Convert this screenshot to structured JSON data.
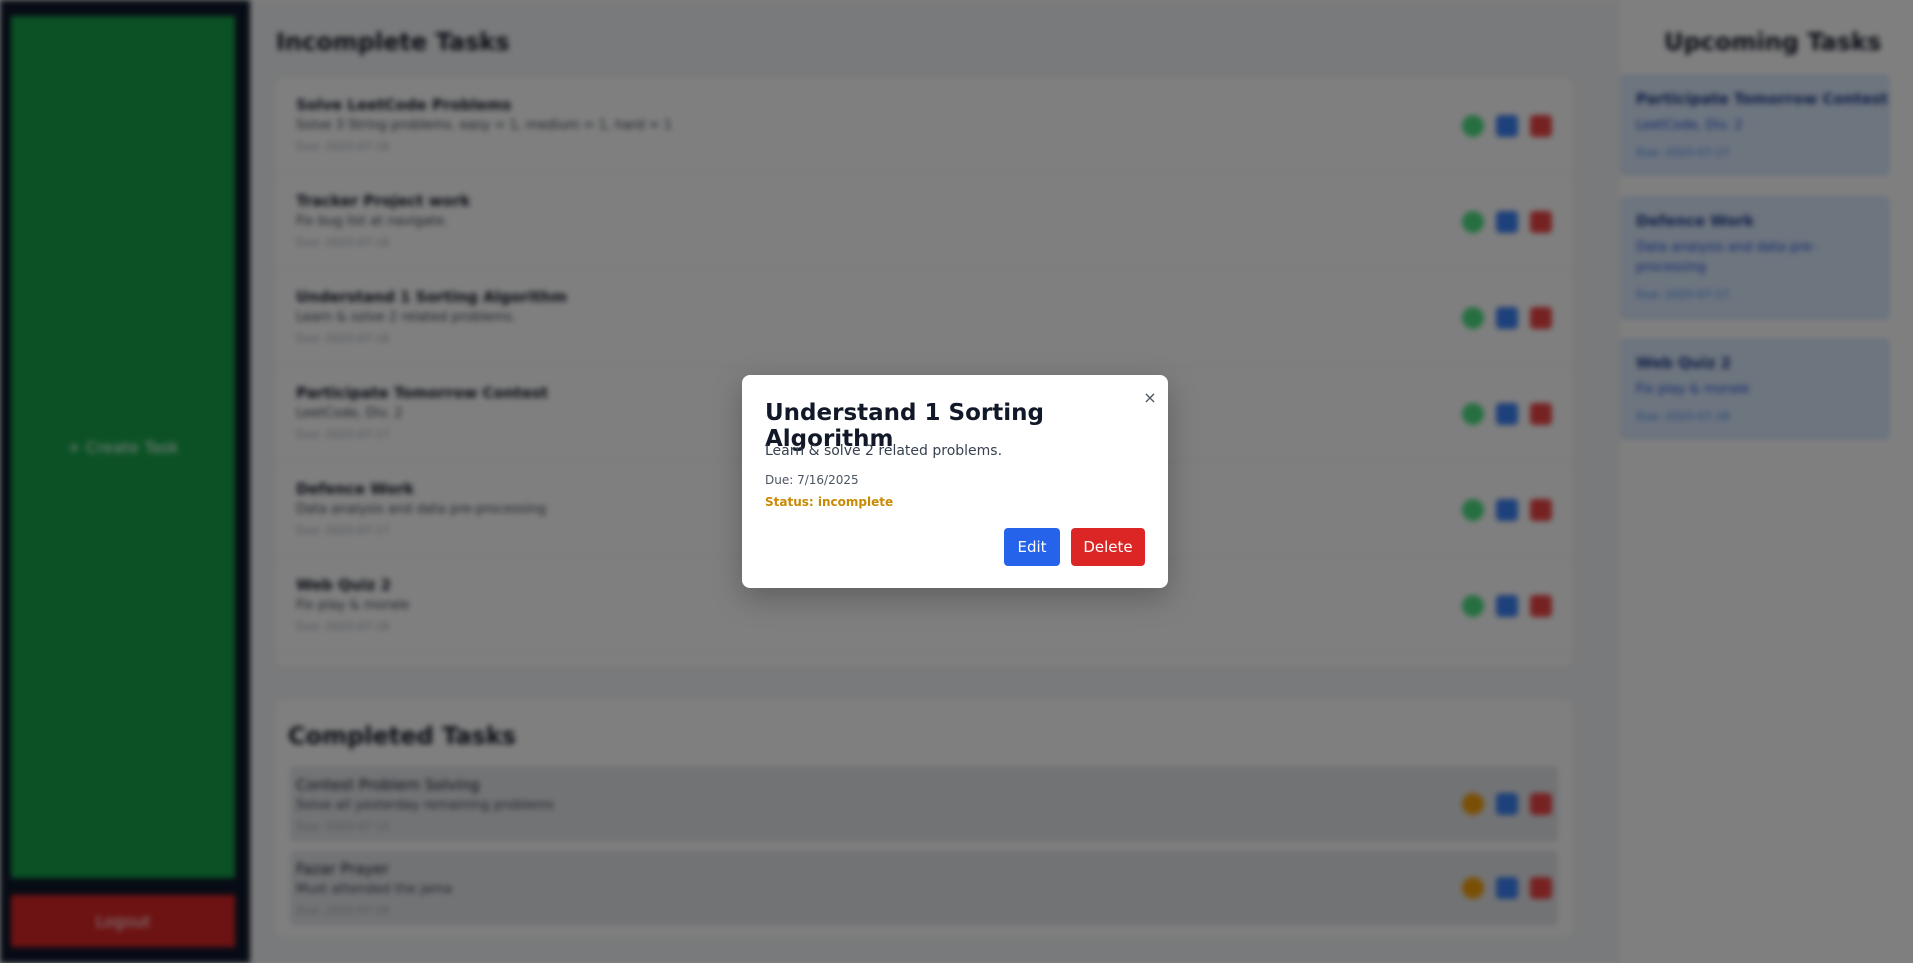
{
  "sidebar": {
    "create_label": "+ Create Task",
    "logout_label": "Logout"
  },
  "incomplete": {
    "title": "Incomplete Tasks",
    "tasks": [
      {
        "title": "Solve LeetCode Problems",
        "desc": "Solve 3 String problems. easy = 1, medium = 1, hard = 1",
        "due": "Due: 2025-07-16"
      },
      {
        "title": "Tracker Project work",
        "desc": "Fix bug list at navigate.",
        "due": "Due: 2025-07-16"
      },
      {
        "title": "Understand 1 Sorting Algorithm",
        "desc": "Learn & solve 2 related problems.",
        "due": "Due: 2025-07-16"
      },
      {
        "title": "Participate Tomorrow Contest",
        "desc": "LeetCode, Div. 2",
        "due": "Due: 2025-07-17"
      },
      {
        "title": "Defence Work",
        "desc": "Data analysis and data pre-processing",
        "due": "Due: 2025-07-17"
      },
      {
        "title": "Web Quiz 2",
        "desc": "Fix play & morale",
        "due": "Due: 2025-07-18"
      }
    ]
  },
  "completed": {
    "title": "Completed Tasks",
    "tasks": [
      {
        "title": "Contest Problem Solving",
        "desc": "Solve all yesterday remaining problems",
        "due": "Due: 2025-07-15"
      },
      {
        "title": "Fazar Prayer",
        "desc": "Must attended the jama",
        "due": "Due: 2025-07-16"
      }
    ]
  },
  "upcoming": {
    "title": "Upcoming Tasks",
    "tasks": [
      {
        "title": "Participate Tomorrow Contest",
        "desc": "LeetCode, Div. 2",
        "due": "Due: 2025-07-17"
      },
      {
        "title": "Defence Work",
        "desc": "Data analysis and data pre-processing",
        "due": "Due: 2025-07-17"
      },
      {
        "title": "Web Quiz 2",
        "desc": "Fix play & morale",
        "due": "Due: 2025-07-18"
      }
    ]
  },
  "modal": {
    "close_glyph": "×",
    "title": "Understand 1 Sorting Algorithm",
    "description": "Learn & solve 2 related problems.",
    "due": "Due: 7/16/2025",
    "status": "Status: incomplete",
    "edit_label": "Edit",
    "delete_label": "Delete"
  },
  "icons": {
    "complete": "check-circle-icon",
    "edit": "edit-icon",
    "delete": "trash-icon",
    "undo": "undo-icon",
    "close": "close-icon"
  },
  "colors": {
    "create": "#16a34a",
    "logout": "#dc2626",
    "edit": "#2563eb",
    "delete": "#dc2626",
    "status_incomplete": "#ca8a04"
  }
}
